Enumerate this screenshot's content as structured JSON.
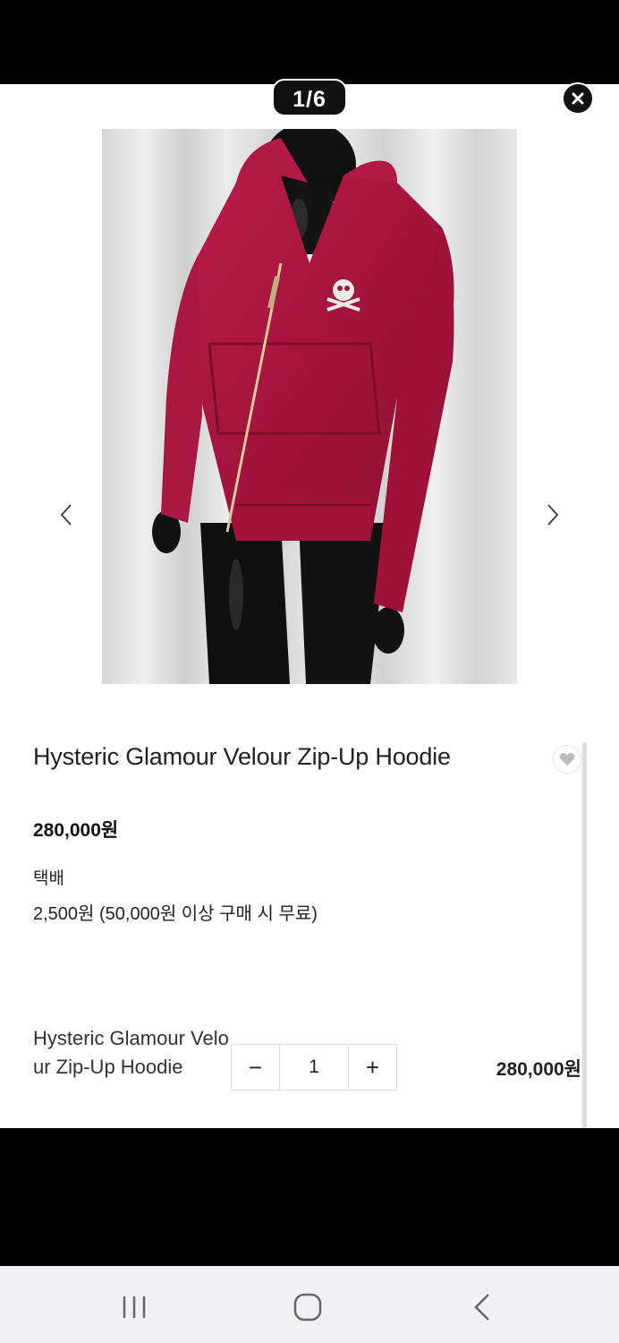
{
  "viewer": {
    "counter": "1/6",
    "photo_alt": "red velour zip-up hoodie on mannequin"
  },
  "product": {
    "title": "Hysteric Glamour Velour Zip-Up Hoodie",
    "price": "280,000원",
    "shipping_label": "택배",
    "shipping_fee": "2,500원 (50,000원 이상 구매 시 무료)"
  },
  "option": {
    "name": "Hysteric Glamour Velour Zip-Up Hoodie",
    "quantity": "1",
    "minus": "−",
    "plus": "+",
    "price": "280,000원"
  },
  "icons": {
    "close": "close-icon",
    "prev": "chevron-left-icon",
    "next": "chevron-right-icon",
    "wish": "heart-icon",
    "recent": "recent-apps-icon",
    "home": "home-icon",
    "back": "back-icon"
  },
  "colors": {
    "hoodie": "#a8163f",
    "mannequin": "#101010",
    "curtain": "#e4e4e4"
  }
}
